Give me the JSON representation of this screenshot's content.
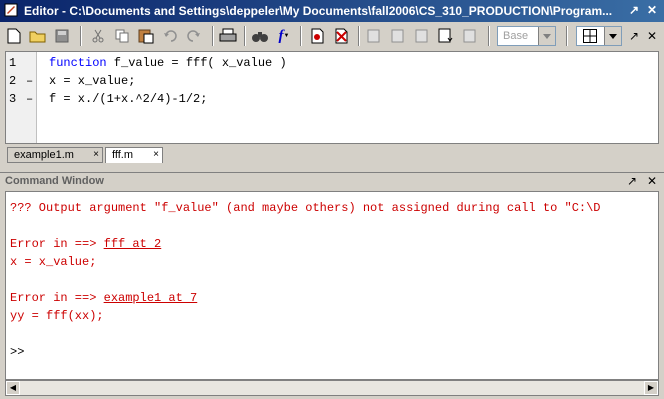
{
  "window": {
    "title": "Editor - C:\\Documents and Settings\\deppeler\\My Documents\\fall2006\\CS_310_PRODUCTION\\Program..."
  },
  "toolbar": {
    "stack_combo": "Base"
  },
  "editor": {
    "lines": [
      {
        "num": "1",
        "mark": "",
        "keyword": "function",
        "text": " f_value = fff( x_value )"
      },
      {
        "num": "2",
        "mark": "–",
        "keyword": "",
        "text": "x = x_value;"
      },
      {
        "num": "3",
        "mark": "–",
        "keyword": "",
        "text": "f = x./(1+x.^2/4)-1/2;"
      }
    ],
    "tabs": [
      {
        "label": "example1.m",
        "close": "×"
      },
      {
        "label": "fff.m",
        "close": "×"
      }
    ]
  },
  "command_window": {
    "title": "Command Window",
    "error_line": "??? Output argument \"f_value\" (and maybe others) not assigned during call to \"C:\\D",
    "err1_prefix": "Error in ==> ",
    "err1_link": "fff at 2",
    "err1_code": "x = x_value;",
    "err2_prefix": "Error in ==> ",
    "err2_link": "example1 at 7",
    "err2_code": "yy = fff(xx);",
    "prompt": ">>"
  }
}
